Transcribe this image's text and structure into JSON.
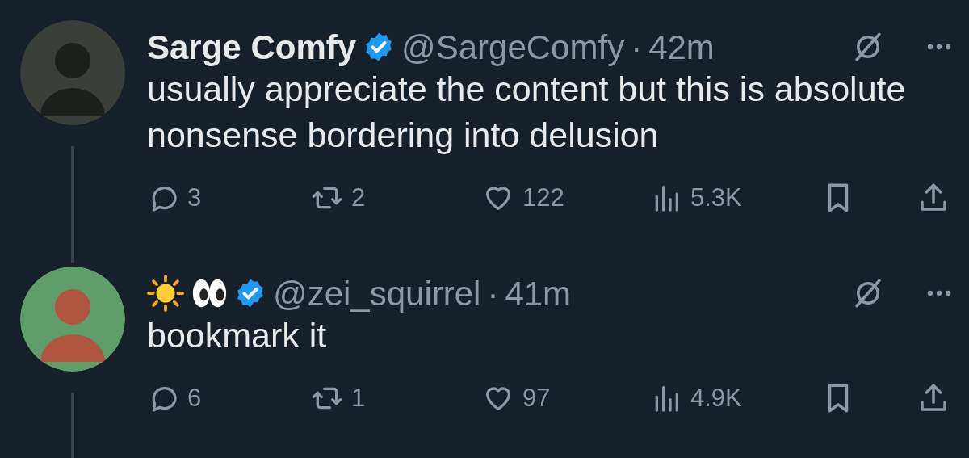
{
  "tweets": [
    {
      "author": {
        "name": "Sarge Comfy",
        "verified": true,
        "handle": "@SargeComfy",
        "separator": "·",
        "time": "42m"
      },
      "text": "usually appreciate the content but this is absolute nonsense bordering into delusion",
      "stats": {
        "replies": "3",
        "reposts": "2",
        "likes": "122",
        "views": "5.3K"
      }
    },
    {
      "author": {
        "name_emoji": [
          {
            "kind": "sun"
          },
          {
            "kind": "eyes"
          }
        ],
        "verified": true,
        "handle": "@zei_squirrel",
        "separator": "·",
        "time": "41m"
      },
      "text": "bookmark it",
      "stats": {
        "replies": "6",
        "reposts": "1",
        "likes": "97",
        "views": "4.9K"
      }
    }
  ]
}
